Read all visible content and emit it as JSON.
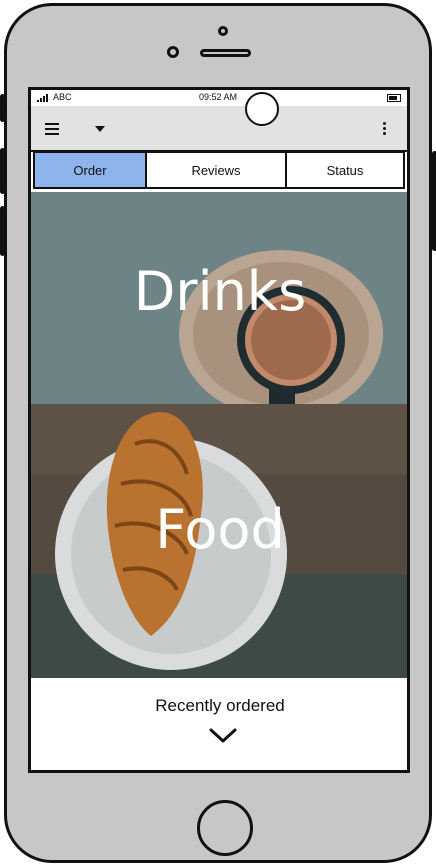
{
  "status_bar": {
    "carrier": "ABC",
    "time": "09:52 AM"
  },
  "app_bar": {
    "menu_icon": "hamburger-menu-icon",
    "dropdown_icon": "caret-down-icon",
    "more_icon": "kebab-more-icon"
  },
  "tabs": [
    {
      "label": "Order",
      "selected": true
    },
    {
      "label": "Reviews",
      "selected": false
    },
    {
      "label": "Status",
      "selected": false
    }
  ],
  "categories": [
    {
      "label": "Drinks"
    },
    {
      "label": "Food"
    }
  ],
  "recent": {
    "label": "Recently ordered",
    "icon": "chevron-down-icon"
  },
  "colors": {
    "selected_tab": "#8fb3ec",
    "app_bar": "#e2e2e2",
    "phone_frame": "#c7c7c7"
  }
}
